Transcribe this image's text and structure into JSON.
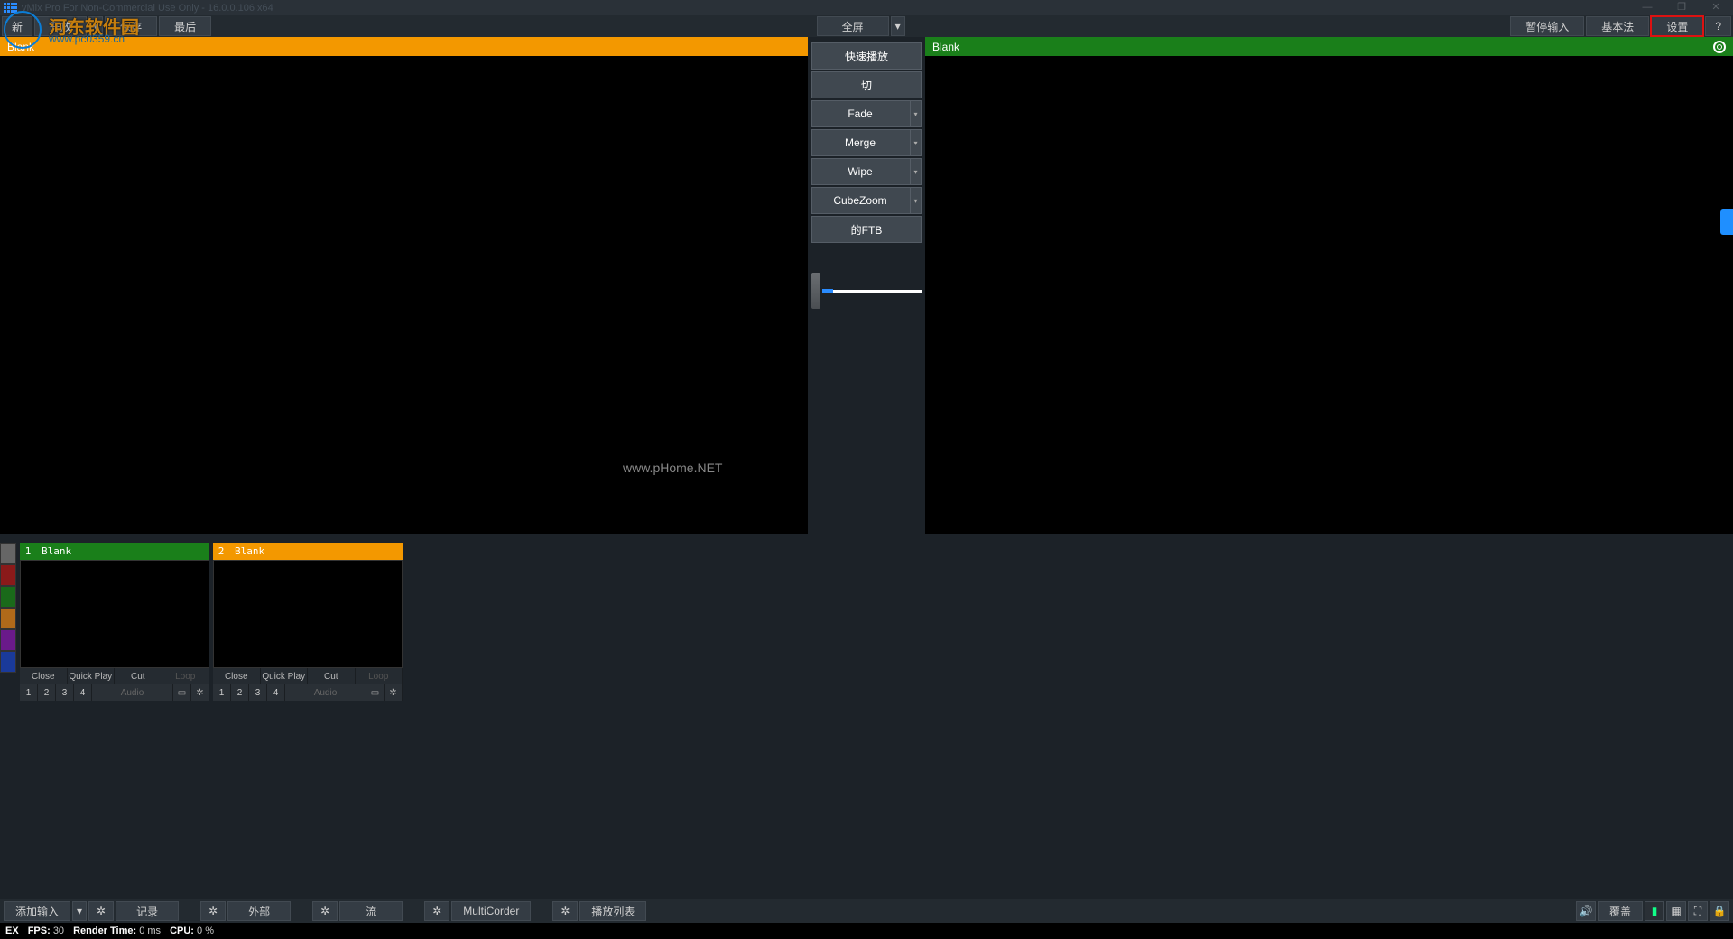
{
  "title": "vMix Pro For Non-Commercial Use Only - 16.0.0.106 x64",
  "toolbar": {
    "new": "新",
    "open": "开放",
    "save": "保存",
    "last": "最后",
    "fullscreen": "全屏",
    "pauseInput": "暂停输入",
    "basic": "基本法",
    "settings": "设置",
    "help": "?"
  },
  "panes": {
    "preview": "Blank",
    "output": "Blank"
  },
  "transitions": {
    "quick": "快速播放",
    "cut": "切",
    "fade": "Fade",
    "merge": "Merge",
    "wipe": "Wipe",
    "cube": "CubeZoom",
    "ftb": "的FTB"
  },
  "watermark": {
    "brand": "河东软件园",
    "url": "www.pc0359.cn",
    "center": "www.pHome.NET"
  },
  "inputs": [
    {
      "num": "1",
      "label": "Blank",
      "colorClass": "green"
    },
    {
      "num": "2",
      "label": "Blank",
      "colorClass": "orange"
    }
  ],
  "tileActions": {
    "close": "Close",
    "quick": "Quick Play",
    "cut": "Cut",
    "loop": "Loop",
    "audio": "Audio"
  },
  "nums": [
    "1",
    "2",
    "3",
    "4"
  ],
  "bottom": {
    "addInput": "添加输入",
    "record": "记录",
    "external": "外部",
    "stream": "流",
    "multicorder": "MultiCorder",
    "playlist": "播放列表",
    "overlay": "覆盖"
  },
  "status": {
    "ex": "EX",
    "fpsL": "FPS:",
    "fps": "30",
    "rtL": "Render Time:",
    "rt": "0 ms",
    "cpuL": "CPU:",
    "cpu": "0 %"
  }
}
